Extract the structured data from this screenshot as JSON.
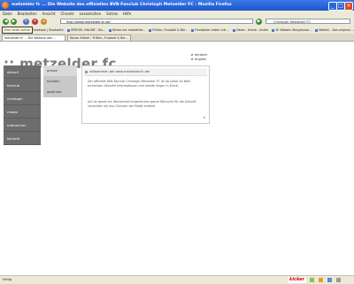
{
  "window": {
    "title": "metzelder fc ... Die Website des offiziellen BVB-Fanclub Christoph Metzelder FC - Mozilla Firefox"
  },
  "menubar": {
    "items": [
      "Datei",
      "Bearbeiten",
      "Ansicht",
      "Chronik",
      "Lesezeichen",
      "Extras",
      "Hilfe"
    ]
  },
  "navbar": {
    "url": "http://www.metzelder-fc.de/",
    "search_value": "Christoph Metzelder FC"
  },
  "tooltip": {
    "text": "Eine Seite zurück"
  },
  "bookmarks": [
    "Facebook | Startseite",
    "SPIEGEL ONLINE - Na...",
    "Nemo vor marketfor...",
    "Fritten, Fussball & Bie...",
    "Fussballer reden mit ...",
    "News - Home - kicker",
    "Dr Wassim Burghause...",
    "Netlink - Das original ..."
  ],
  "tabs": [
    {
      "label": "metzelder fc ... Die Website des ..."
    },
    {
      "label": "Neuer Artikel ‹ Fritten, Fussball & Bie..."
    }
  ],
  "page": {
    "logo": ":: metzelder fc",
    "languages": [
      "deutsch",
      "english"
    ],
    "nav_primary": [
      "aktuell",
      "fanclub",
      "christoph",
      "media",
      "mitmachen",
      "kontakt"
    ],
    "nav_sub": [
      "presse",
      "bündeln",
      "gewinner"
    ],
    "welcome": {
      "title": "willkommen bei www.metzelder-fc.de!",
      "p1": "Der offizielle BVB-Fanclub Christoph Metzelder FC ist ab sofort im Netz erreichbar. Aktuelle Informationen und Inhalte folgen in Kürze.",
      "p2": "Auf de ganze ein Wochenziel eingereichen ganze Wünsche für die Zukunft verzichten wir aus Gründen der Pietät erstmal.",
      "close_glyph": "x"
    }
  },
  "statusbar": {
    "text": "Fertig",
    "badge": "kicker"
  },
  "colors": {
    "titlebar": "#2a63d8",
    "nav_primary": "#6d6d6d",
    "nav_sub": "#c8c8c8",
    "kicker": "#d40000"
  }
}
